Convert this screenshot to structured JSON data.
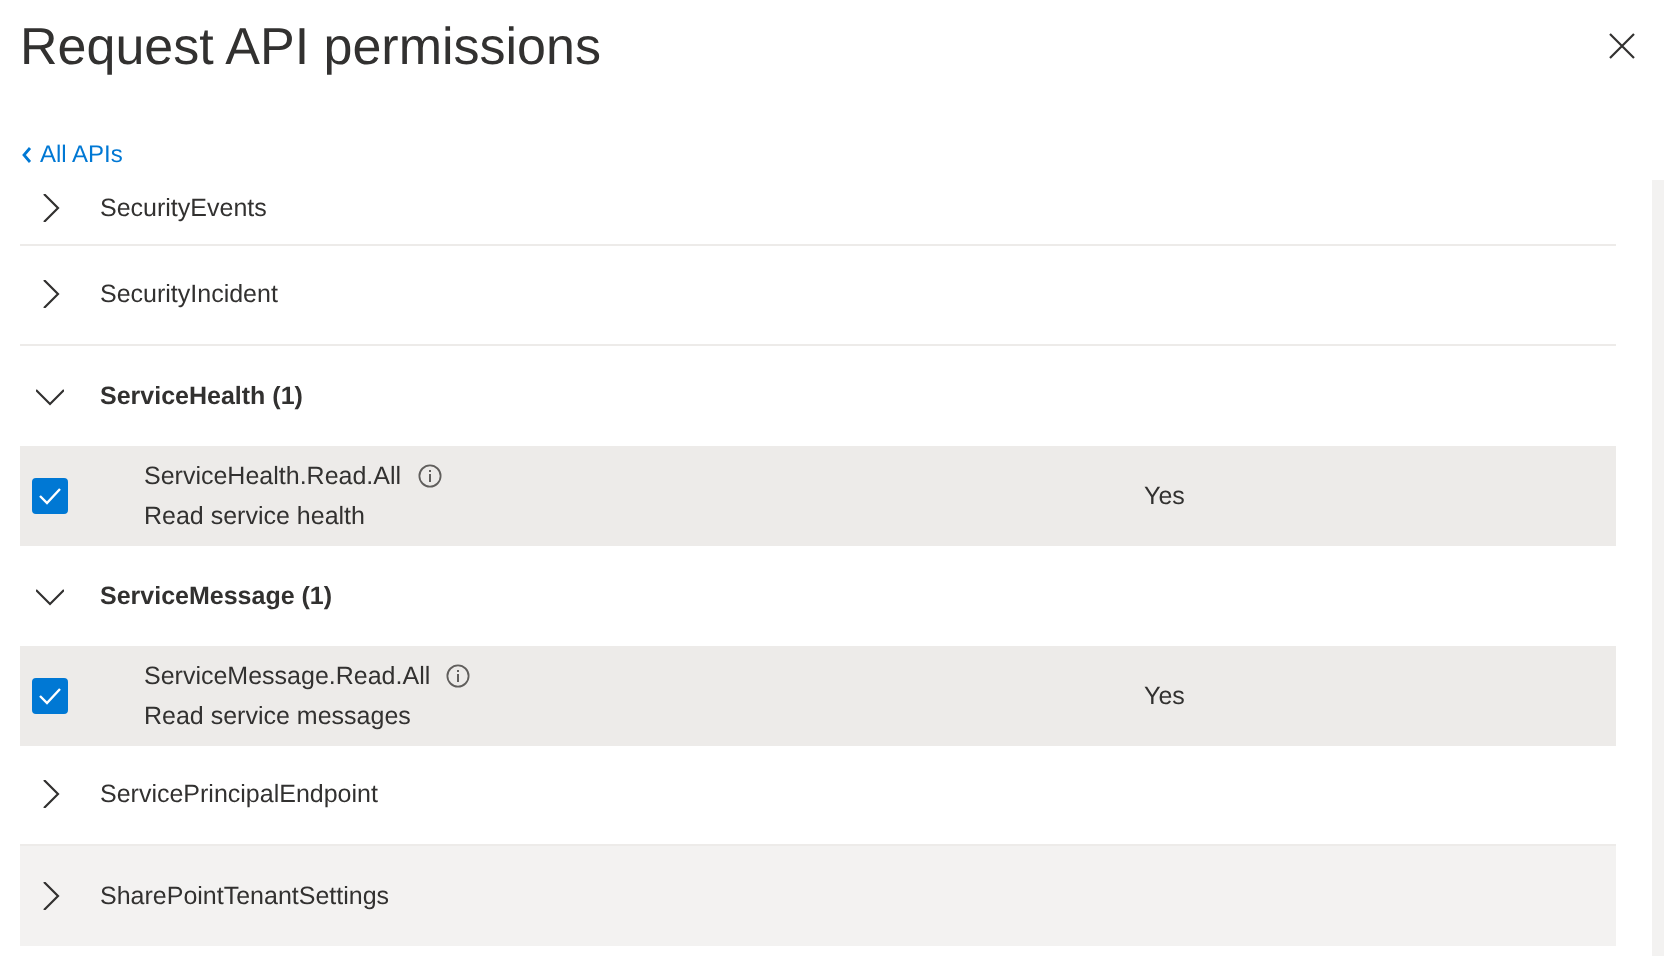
{
  "panel": {
    "title": "Request API permissions",
    "back_link": "All APIs"
  },
  "items": [
    {
      "kind": "group",
      "name": "SecurityEvents",
      "expanded": false,
      "highlighted": false
    },
    {
      "kind": "group",
      "name": "SecurityIncident",
      "expanded": false,
      "highlighted": false
    },
    {
      "kind": "group",
      "name": "ServiceHealth (1)",
      "expanded": true,
      "highlighted": false
    },
    {
      "kind": "permission",
      "name": "ServiceHealth.Read.All",
      "description": "Read service health",
      "admin_consent": "Yes",
      "checked": true
    },
    {
      "kind": "group",
      "name": "ServiceMessage (1)",
      "expanded": true,
      "highlighted": false
    },
    {
      "kind": "permission",
      "name": "ServiceMessage.Read.All",
      "description": "Read service messages",
      "admin_consent": "Yes",
      "checked": true
    },
    {
      "kind": "group",
      "name": "ServicePrincipalEndpoint",
      "expanded": false,
      "highlighted": false
    },
    {
      "kind": "group",
      "name": "SharePointTenantSettings",
      "expanded": false,
      "highlighted": true
    }
  ]
}
